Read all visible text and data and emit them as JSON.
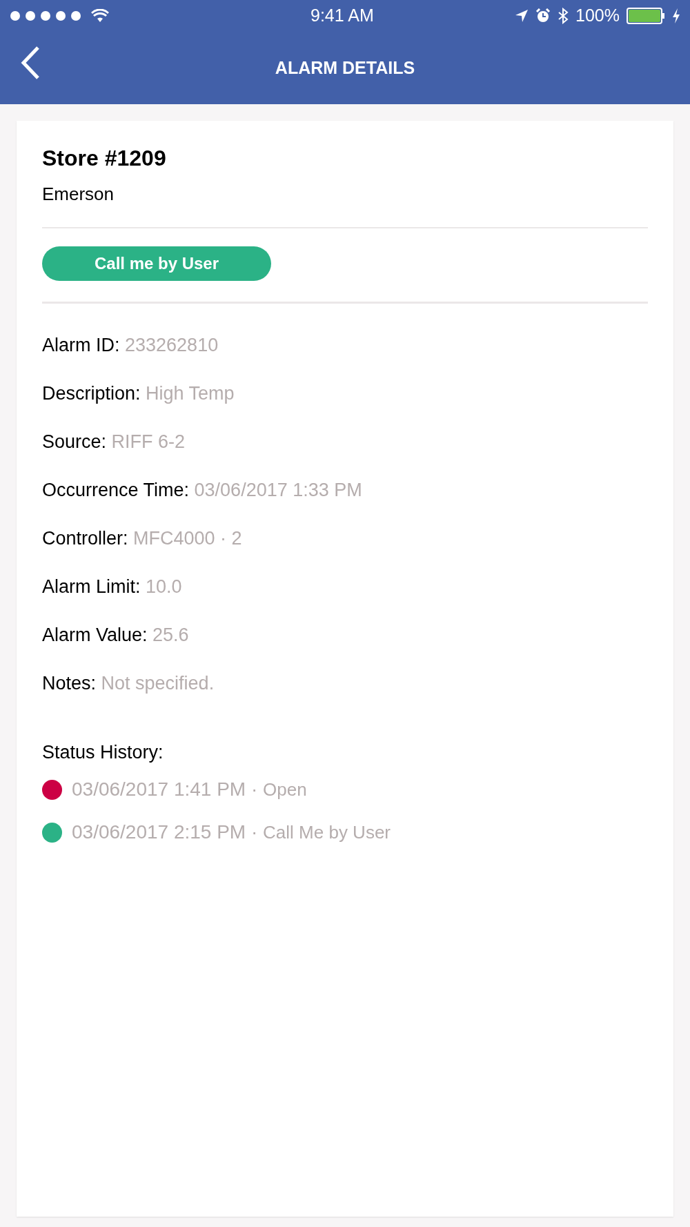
{
  "status_bar": {
    "time": "9:41 AM",
    "battery_percent": "100%"
  },
  "nav_bar": {
    "title": "ALARM DETAILS"
  },
  "card": {
    "title": "Store #1209",
    "subtitle": "Emerson",
    "status_badge": {
      "label": "Call me by User",
      "color": "#2bb286"
    },
    "fields": [
      {
        "label": "Alarm ID:",
        "value": "233262810"
      },
      {
        "label": "Description:",
        "value": "High Temp"
      },
      {
        "label": "Source:",
        "value": "RIFF 6-2"
      },
      {
        "label": "Occurrence Time:",
        "value": "03/06/2017 1:33 PM"
      },
      {
        "label": "Controller:",
        "value": "MFC4000 · 2"
      },
      {
        "label": "Alarm Limit:",
        "value": "10.0"
      },
      {
        "label": "Alarm Value:",
        "value": "25.6"
      },
      {
        "label": "Notes:",
        "value": "Not specified."
      }
    ],
    "status_history": {
      "heading": "Status History:",
      "entries": [
        {
          "time": "03/06/2017 1:41 PM",
          "separator": "·",
          "status": "Open",
          "color": "#cc0044"
        },
        {
          "time": "03/06/2017 2:15 PM",
          "separator": "·",
          "status": "Call Me by User",
          "color": "#2bb286"
        }
      ]
    }
  }
}
